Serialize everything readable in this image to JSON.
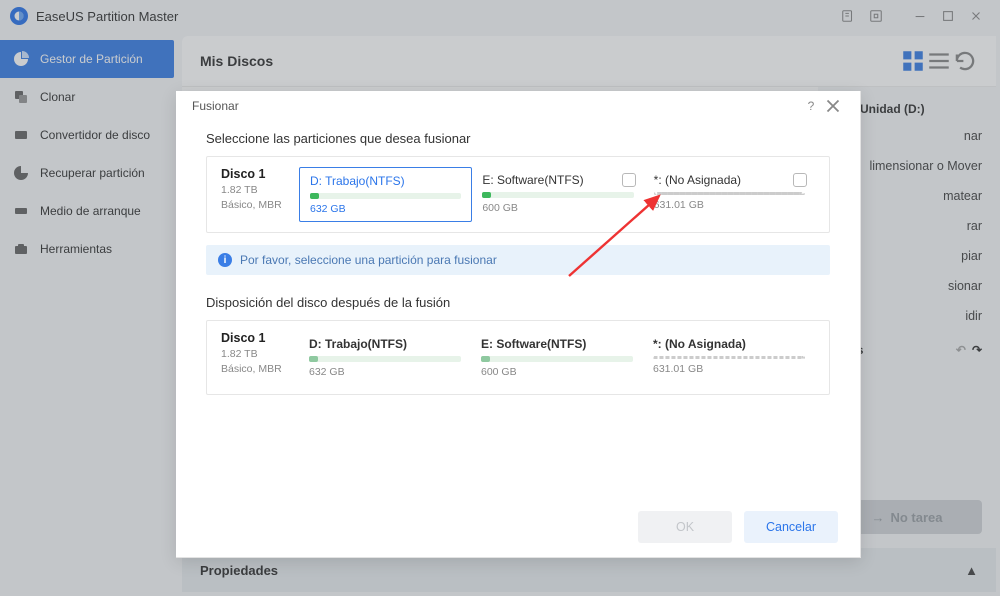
{
  "titlebar": {
    "title": "EaseUS Partition Master"
  },
  "sidebar": {
    "items": [
      {
        "label": "Gestor de Partición",
        "active": true
      },
      {
        "label": "Clonar"
      },
      {
        "label": "Convertidor de disco"
      },
      {
        "label": "Recuperar partición"
      },
      {
        "label": "Medio de arranque"
      },
      {
        "label": "Herramientas"
      }
    ]
  },
  "content": {
    "header": "Mis Discos",
    "properties": "Propiedades"
  },
  "rightPanel": {
    "drive": "Unidad (D:)",
    "items": [
      "nar",
      "limensionar o Mover",
      "matear",
      "rar",
      "piar",
      "sionar",
      "idir"
    ],
    "tasks": "areas",
    "noTask": "No tarea"
  },
  "modal": {
    "title": "Fusionar",
    "section1": "Seleccione las particiones que desea fusionar",
    "disk": {
      "name": "Disco 1",
      "size": "1.82 TB",
      "type": "Básico, MBR"
    },
    "partitions": [
      {
        "name": "D: Trabajo(NTFS)",
        "size": "632 GB",
        "selected": true,
        "fill": 6
      },
      {
        "name": "E: Software(NTFS)",
        "size": "600 GB",
        "checkbox": true,
        "fill": 6
      },
      {
        "name": "*: (No Asignada)",
        "size": "631.01 GB",
        "checkbox": true,
        "dashed": true
      }
    ],
    "info": "Por favor, seleccione una partición para fusionar",
    "section2": "Disposición del disco después de la fusión",
    "ok": "OK",
    "cancel": "Cancelar"
  }
}
